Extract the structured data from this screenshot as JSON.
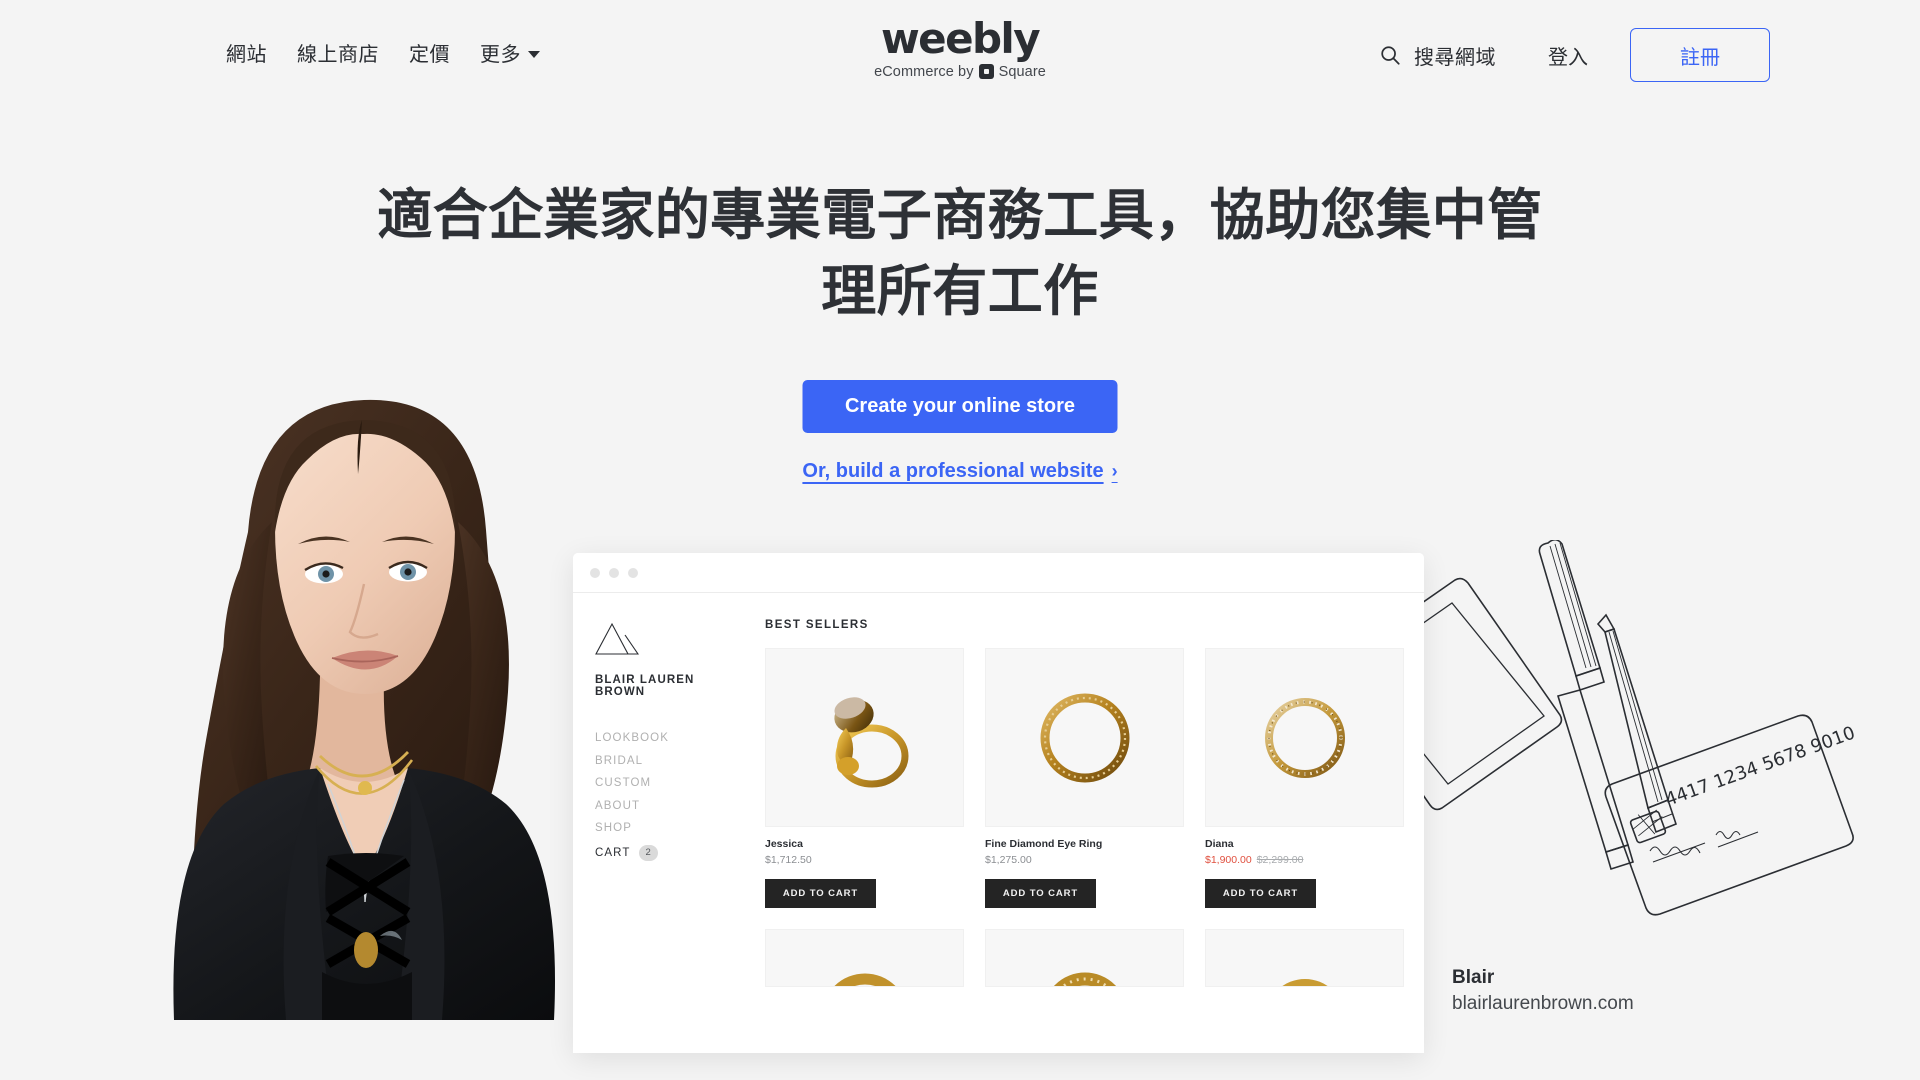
{
  "theme": {
    "page_bg": "#f4f4f4",
    "accent_blue": "#3b65f5",
    "text_dark": "#2b2e33",
    "sale_red": "#e0503f"
  },
  "header": {
    "nav_left": [
      {
        "label": "網站"
      },
      {
        "label": "線上商店"
      },
      {
        "label": "定價"
      },
      {
        "label": "更多"
      }
    ],
    "logo": {
      "name": "weebly",
      "tagline_before": "eCommerce by",
      "tagline_after": "Square",
      "square_icon": "square-logo-icon"
    },
    "search": {
      "icon": "search-icon",
      "label": "搜尋網域"
    },
    "login_label": "登入",
    "signup_label": "註冊",
    "caret_icon": "chevron-down-icon"
  },
  "hero": {
    "title": "適合企業家的專業電子商務工具，協助您集中管理所有工作",
    "cta_button": "Create your online store",
    "cta_link": "Or, build a professional website",
    "cta_link_chevron": "›"
  },
  "showcase": {
    "caption_name": "Blair",
    "caption_url": "blairlaurenbrown.com",
    "browser_dots": 3,
    "store": {
      "logo_icon": "triangle-logo-icon",
      "name": "BLAIR LAUREN BROWN",
      "nav": [
        {
          "label": "LOOKBOOK"
        },
        {
          "label": "BRIDAL"
        },
        {
          "label": "CUSTOM"
        },
        {
          "label": "ABOUT"
        },
        {
          "label": "SHOP"
        }
      ],
      "cart": {
        "label": "CART",
        "count": "2"
      },
      "section_title": "BEST SELLERS",
      "products": [
        {
          "name": "Jessica",
          "price": "$1,712.50",
          "sale_price": "",
          "original_price": "",
          "add_label": "ADD TO CART",
          "image": "gold-ring-gemstone"
        },
        {
          "name": "Fine Diamond Eye Ring",
          "price": "$1,275.00",
          "sale_price": "",
          "original_price": "",
          "add_label": "ADD TO CART",
          "image": "gold-band-ring"
        },
        {
          "name": "Diana",
          "price": "",
          "sale_price": "$1,900.00",
          "original_price": "$2,299.00",
          "add_label": "ADD TO CART",
          "image": "gold-eternity-ring"
        }
      ]
    }
  },
  "illustration": {
    "card_number": "4417 1234 5678 9010",
    "items": [
      "tablet-outline",
      "pen-outline",
      "pencil-outline",
      "credit-card-outline"
    ]
  }
}
